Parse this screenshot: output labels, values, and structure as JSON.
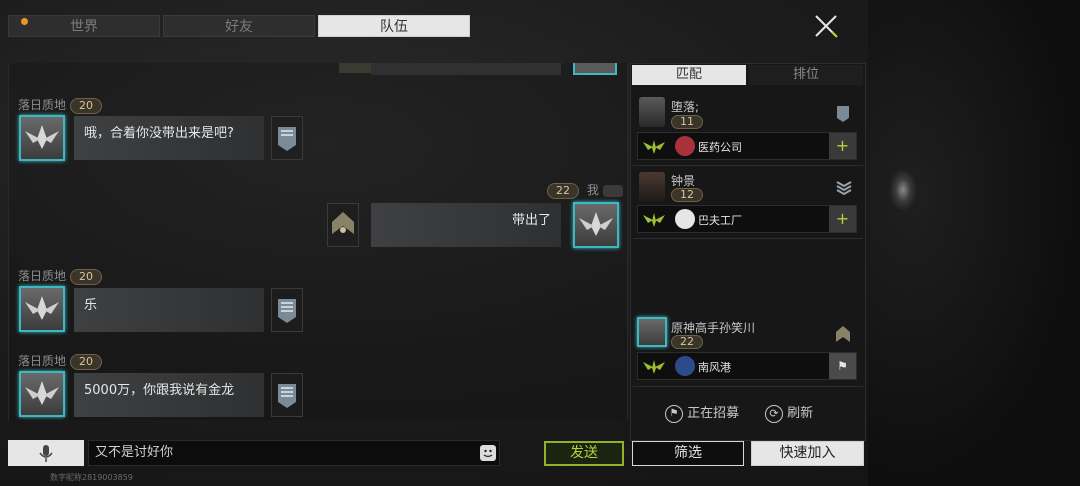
{
  "tabs": [
    {
      "label": "世界"
    },
    {
      "label": "好友"
    },
    {
      "label": "队伍"
    }
  ],
  "messages": [
    {
      "name": "落日质地",
      "level": "20",
      "text": "哦，合着你没带出来是吧?"
    },
    {
      "name": "我",
      "level": "22",
      "text": "带出了"
    },
    {
      "name": "落日质地",
      "level": "20",
      "text": "乐"
    },
    {
      "name": "落日质地",
      "level": "20",
      "text": "5000万，你跟我说有金龙"
    }
  ],
  "input": {
    "value": "又不是讨好你"
  },
  "send_label": "发送",
  "user_id": "数字昵称2819003859",
  "panel": {
    "tabs": [
      {
        "label": "匹配"
      },
      {
        "label": "排位"
      }
    ],
    "members": [
      {
        "name": "堕落;",
        "level": "11",
        "faction": "医药公司"
      },
      {
        "name": "钟景",
        "level": "12",
        "faction": "巴夫工厂"
      },
      {
        "name": "原神高手孙笑川",
        "level": "22",
        "faction": "南风港"
      }
    ],
    "recruiting_label": "正在招募",
    "refresh_label": "刷新"
  },
  "filter_label": "筛选",
  "quick_join_label": "快速加入"
}
